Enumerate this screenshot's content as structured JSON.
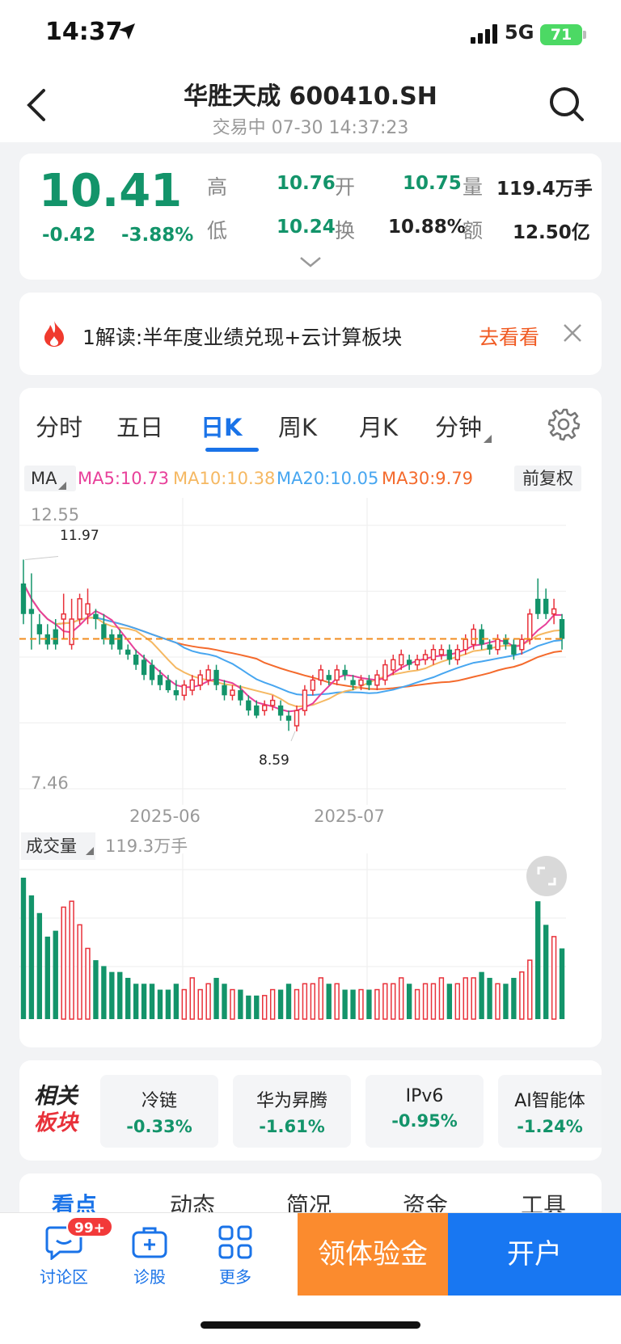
{
  "status": {
    "time": "14:37",
    "network": "5G",
    "battery": "71"
  },
  "header": {
    "title": "华胜天成 600410.SH",
    "subtitle": "交易中 07-30 14:37:23"
  },
  "quote": {
    "price": "10.41",
    "change": "-0.42",
    "change_pct": "-3.88%",
    "high_label": "高",
    "high": "10.76",
    "open_label": "开",
    "open": "10.75",
    "volume_label": "量",
    "volume": "119.4万手",
    "low_label": "低",
    "low": "10.24",
    "turnover_label": "换",
    "turnover": "10.88%",
    "amount_label": "额",
    "amount": "12.50亿"
  },
  "banner": {
    "text": "1解读:半年度业绩兑现+云计算板块",
    "action": "去看看"
  },
  "chart_tabs": [
    "分时",
    "五日",
    "日K",
    "周K",
    "月K",
    "分钟"
  ],
  "ma": {
    "label": "MA",
    "ma5": "MA5:10.73",
    "ma10": "MA10:10.38",
    "ma20": "MA20:10.05",
    "ma30": "MA30:9.79",
    "adjust": "前复权",
    "colors": {
      "ma5": "#e8409a",
      "ma10": "#f5b862",
      "ma20": "#47a6f0",
      "ma30": "#f46a2c"
    }
  },
  "chart_data": {
    "type": "candlestick",
    "y_top_label": "12.55",
    "y_bottom_label": "7.46",
    "ylim": [
      7.46,
      12.55
    ],
    "high_annotation": "11.97",
    "low_annotation": "8.59",
    "x_labels": [
      "2025-06",
      "2025-07"
    ],
    "last_price_line": 10.41,
    "candles": [
      [
        10.9,
        11.5,
        11.97,
        10.7,
        "d"
      ],
      [
        11.0,
        10.9,
        11.7,
        10.2,
        "d"
      ],
      [
        10.7,
        10.5,
        10.9,
        10.3,
        "d"
      ],
      [
        10.5,
        10.3,
        10.7,
        10.2,
        "d"
      ],
      [
        10.6,
        10.3,
        10.8,
        10.2,
        "d"
      ],
      [
        10.9,
        10.8,
        11.3,
        10.4,
        "u"
      ],
      [
        10.3,
        10.8,
        11.2,
        10.2,
        "u"
      ],
      [
        10.8,
        11.2,
        11.3,
        10.7,
        "u"
      ],
      [
        10.9,
        11.1,
        11.4,
        10.7,
        "u"
      ],
      [
        10.8,
        10.9,
        11.0,
        10.6,
        "d"
      ],
      [
        10.7,
        10.4,
        10.9,
        10.3,
        "d"
      ],
      [
        10.5,
        10.3,
        10.6,
        10.2,
        "d"
      ],
      [
        10.5,
        10.2,
        10.6,
        10.1,
        "d"
      ],
      [
        10.2,
        10.1,
        10.3,
        10.0,
        "d"
      ],
      [
        10.1,
        9.9,
        10.2,
        9.8,
        "d"
      ],
      [
        10.0,
        9.7,
        10.1,
        9.6,
        "d"
      ],
      [
        9.9,
        9.6,
        10.0,
        9.5,
        "d"
      ],
      [
        9.7,
        9.5,
        9.8,
        9.4,
        "d"
      ],
      [
        9.6,
        9.4,
        9.7,
        9.35,
        "d"
      ],
      [
        9.4,
        9.3,
        9.6,
        9.2,
        "d"
      ],
      [
        9.3,
        9.5,
        9.6,
        9.2,
        "u"
      ],
      [
        9.4,
        9.6,
        9.7,
        9.3,
        "u"
      ],
      [
        9.5,
        9.7,
        9.8,
        9.4,
        "u"
      ],
      [
        9.6,
        9.8,
        9.9,
        9.5,
        "u"
      ],
      [
        9.8,
        9.5,
        9.9,
        9.4,
        "d"
      ],
      [
        9.5,
        9.3,
        9.6,
        9.2,
        "d"
      ],
      [
        9.3,
        9.4,
        9.5,
        9.2,
        "u"
      ],
      [
        9.4,
        9.2,
        9.5,
        9.1,
        "d"
      ],
      [
        9.2,
        9.0,
        9.3,
        8.9,
        "d"
      ],
      [
        9.1,
        8.9,
        9.2,
        8.85,
        "d"
      ],
      [
        9.0,
        9.1,
        9.2,
        8.9,
        "u"
      ],
      [
        9.1,
        9.2,
        9.3,
        9.0,
        "u"
      ],
      [
        9.1,
        8.9,
        9.2,
        8.8,
        "d"
      ],
      [
        8.9,
        8.8,
        9.0,
        8.6,
        "d"
      ],
      [
        8.7,
        9.0,
        9.1,
        8.59,
        "u"
      ],
      [
        9.0,
        9.4,
        9.5,
        8.9,
        "u"
      ],
      [
        9.4,
        9.6,
        9.7,
        9.3,
        "u"
      ],
      [
        9.6,
        9.8,
        9.9,
        9.5,
        "u"
      ],
      [
        9.7,
        9.6,
        9.8,
        9.5,
        "d"
      ],
      [
        9.6,
        9.8,
        9.9,
        9.5,
        "u"
      ],
      [
        9.8,
        9.7,
        9.9,
        9.6,
        "d"
      ],
      [
        9.6,
        9.5,
        9.7,
        9.4,
        "d"
      ],
      [
        9.5,
        9.6,
        9.7,
        9.4,
        "u"
      ],
      [
        9.6,
        9.5,
        9.7,
        9.4,
        "d"
      ],
      [
        9.5,
        9.7,
        9.8,
        9.4,
        "u"
      ],
      [
        9.6,
        9.9,
        10.0,
        9.5,
        "u"
      ],
      [
        9.8,
        10.0,
        10.1,
        9.7,
        "u"
      ],
      [
        9.9,
        10.1,
        10.2,
        9.8,
        "u"
      ],
      [
        10.0,
        9.9,
        10.1,
        9.8,
        "d"
      ],
      [
        9.9,
        10.0,
        10.1,
        9.8,
        "u"
      ],
      [
        10.0,
        10.1,
        10.2,
        9.9,
        "u"
      ],
      [
        10.0,
        10.2,
        10.3,
        9.9,
        "u"
      ],
      [
        10.1,
        10.2,
        10.3,
        10.0,
        "u"
      ],
      [
        10.2,
        10.0,
        10.3,
        9.9,
        "d"
      ],
      [
        10.0,
        10.2,
        10.3,
        9.9,
        "u"
      ],
      [
        10.2,
        10.4,
        10.5,
        10.1,
        "u"
      ],
      [
        10.3,
        10.6,
        10.7,
        10.2,
        "u"
      ],
      [
        10.6,
        10.3,
        10.7,
        10.2,
        "d"
      ],
      [
        10.3,
        10.2,
        10.4,
        10.1,
        "d"
      ],
      [
        10.2,
        10.4,
        10.5,
        10.1,
        "u"
      ],
      [
        10.4,
        10.3,
        10.5,
        10.2,
        "d"
      ],
      [
        10.3,
        10.1,
        10.4,
        10.0,
        "d"
      ],
      [
        10.2,
        10.4,
        10.5,
        10.1,
        "u"
      ],
      [
        10.4,
        10.9,
        11.0,
        10.3,
        "u"
      ],
      [
        10.9,
        11.2,
        11.6,
        10.8,
        "d"
      ],
      [
        11.2,
        10.9,
        11.4,
        10.8,
        "d"
      ],
      [
        10.9,
        11.0,
        11.2,
        10.7,
        "u"
      ],
      [
        10.8,
        10.41,
        10.9,
        10.2,
        "d"
      ]
    ],
    "volume_label": "成交量",
    "volume_value": "119.3万手",
    "volumes": [
      2.4,
      2.1,
      1.8,
      1.4,
      1.5,
      1.9,
      2.0,
      1.6,
      1.2,
      1.0,
      0.9,
      0.8,
      0.8,
      0.7,
      0.6,
      0.6,
      0.6,
      0.5,
      0.5,
      0.6,
      0.5,
      0.7,
      0.5,
      0.6,
      0.7,
      0.6,
      0.5,
      0.5,
      0.4,
      0.4,
      0.4,
      0.5,
      0.5,
      0.6,
      0.5,
      0.6,
      0.6,
      0.7,
      0.6,
      0.6,
      0.5,
      0.5,
      0.5,
      0.5,
      0.5,
      0.6,
      0.6,
      0.7,
      0.6,
      0.5,
      0.6,
      0.6,
      0.7,
      0.6,
      0.6,
      0.7,
      0.7,
      0.8,
      0.7,
      0.6,
      0.6,
      0.7,
      0.8,
      1.0,
      2.0,
      1.6,
      1.4,
      1.2
    ],
    "volume_max": 2.4
  },
  "related": {
    "title_line1": "相关",
    "title_line2": "板块",
    "sectors": [
      {
        "name": "冷链",
        "pct": "-0.33%"
      },
      {
        "name": "华为昇腾",
        "pct": "-1.61%"
      },
      {
        "name": "IPv6",
        "pct": "-0.95%"
      },
      {
        "name": "AI智能体",
        "pct": "-1.24%"
      }
    ]
  },
  "footer_tabs": [
    "看点",
    "动态",
    "简况",
    "资金",
    "工具"
  ],
  "bottom_bar": {
    "discussion": "讨论区",
    "badge": "99+",
    "diagnose": "诊股",
    "more": "更多",
    "cta_gold": "领体验金",
    "cta_open": "开户"
  },
  "colors": {
    "up": "#e8313a",
    "down": "#13946a",
    "accent": "#1a73e8",
    "dashed": "#f28c1f"
  }
}
